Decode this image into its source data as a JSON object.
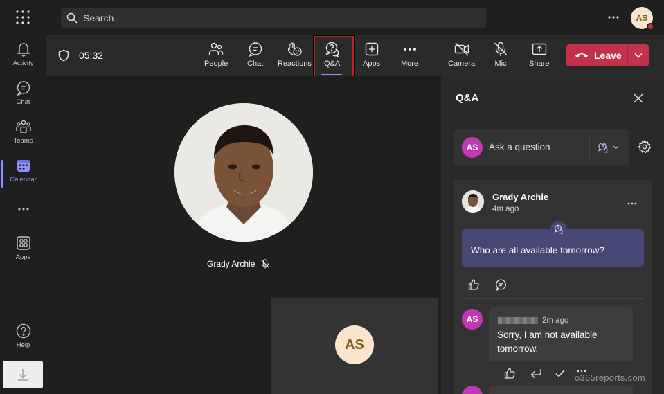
{
  "search": {
    "placeholder": "Search"
  },
  "profile": {
    "initials": "AS"
  },
  "rail": {
    "items": [
      {
        "label": "Activity",
        "icon": "bell-icon"
      },
      {
        "label": "Chat",
        "icon": "chat-icon"
      },
      {
        "label": "Teams",
        "icon": "teams-icon"
      },
      {
        "label": "Calendar",
        "icon": "calendar-icon",
        "active": true
      },
      {
        "label": "",
        "icon": "more-icon"
      },
      {
        "label": "Apps",
        "icon": "apps-icon"
      },
      {
        "label": "Help",
        "icon": "help-icon"
      }
    ]
  },
  "meeting": {
    "timer": "05:32",
    "toolbar": {
      "people": "People",
      "chat": "Chat",
      "reactions": "Reactions",
      "qa": "Q&A",
      "apps": "Apps",
      "more": "More",
      "camera": "Camera",
      "mic": "Mic",
      "share": "Share",
      "leave": "Leave"
    },
    "participant_name": "Grady Archie",
    "tile_initials": "AS"
  },
  "qa_panel": {
    "title": "Q&A",
    "ask_placeholder": "Ask a question",
    "ask_initials": "AS",
    "question": {
      "author": "Grady Archie",
      "time": "4m ago",
      "text": "Who are all available tomorrow?"
    },
    "reply": {
      "initials": "AS",
      "time": "2m ago",
      "text": "Sorry, I am not available tomorrow."
    }
  },
  "watermark": "o365reports.com",
  "colors": {
    "accent": "#8c93ff",
    "leave": "#c4314b",
    "question_bg": "#464775",
    "avatar": "#c239b3"
  }
}
